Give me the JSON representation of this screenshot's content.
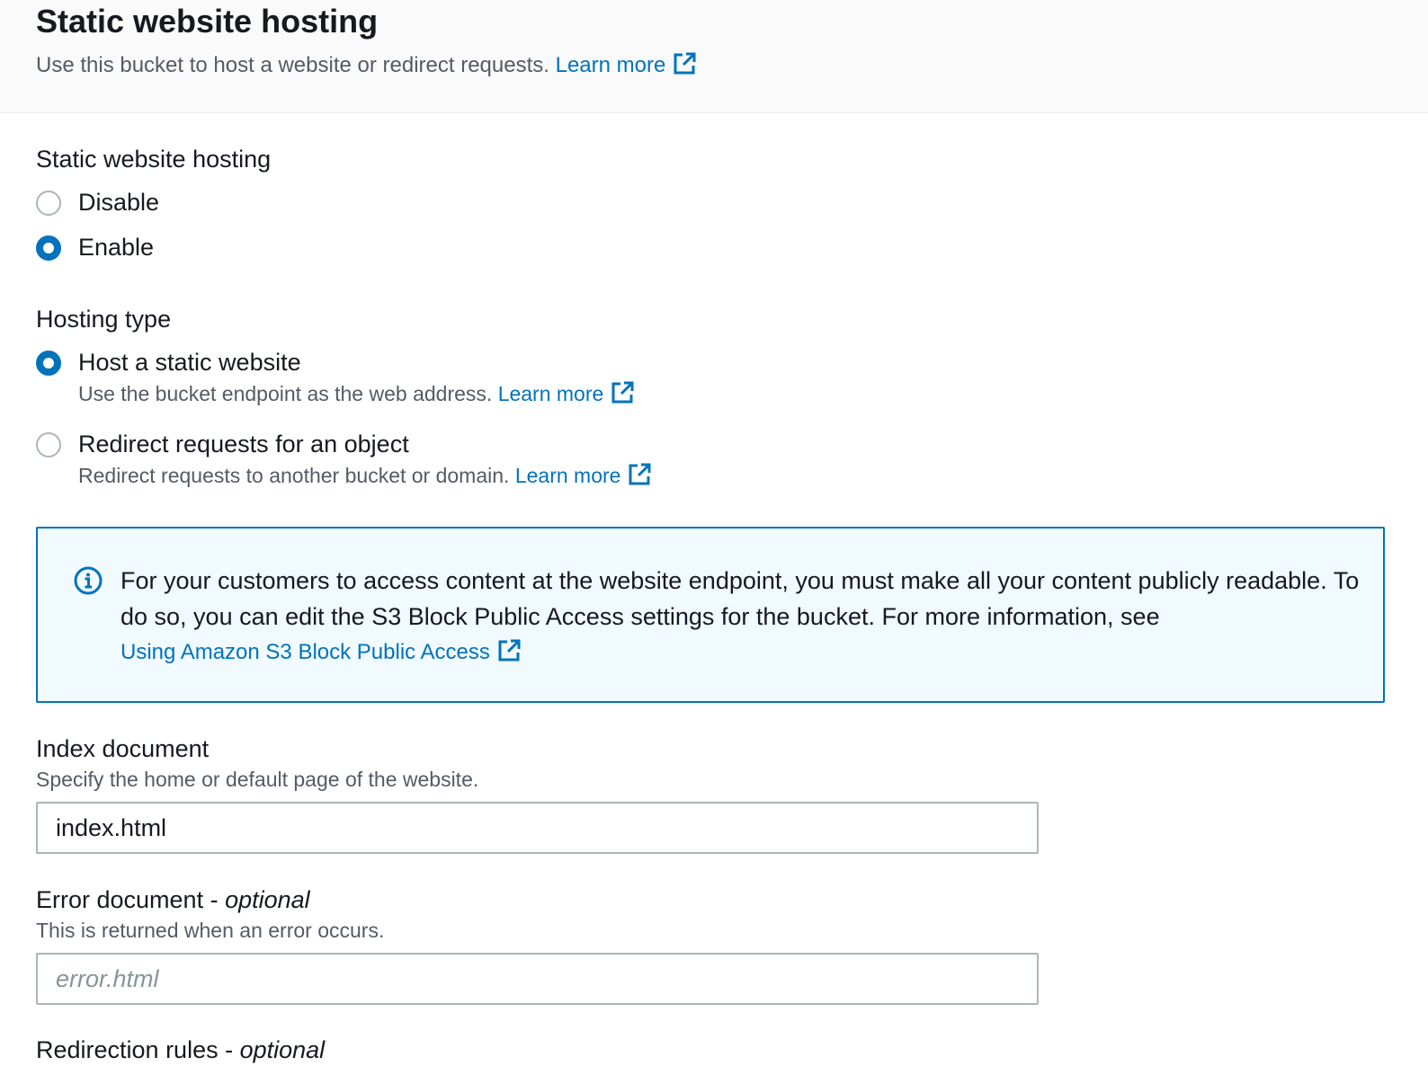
{
  "header": {
    "title": "Static website hosting",
    "description": "Use this bucket to host a website or redirect requests.",
    "learn_more": "Learn more"
  },
  "hosting_toggle": {
    "label": "Static website hosting",
    "options": [
      {
        "label": "Disable",
        "selected": false
      },
      {
        "label": "Enable",
        "selected": true
      }
    ]
  },
  "hosting_type": {
    "label": "Hosting type",
    "options": [
      {
        "label": "Host a static website",
        "description": "Use the bucket endpoint as the web address.",
        "learn_more": "Learn more",
        "selected": true
      },
      {
        "label": "Redirect requests for an object",
        "description": "Redirect requests to another bucket or domain.",
        "learn_more": "Learn more",
        "selected": false
      }
    ]
  },
  "info_alert": {
    "text": "For your customers to access content at the website endpoint, you must make all your content publicly readable. To do so, you can edit the S3 Block Public Access settings for the bucket. For more information, see",
    "link": "Using Amazon S3 Block Public Access"
  },
  "index_document": {
    "label": "Index document",
    "description": "Specify the home or default page of the website.",
    "value": "index.html"
  },
  "error_document": {
    "label": "Error document - ",
    "label_suffix": "optional",
    "description": "This is returned when an error occurs.",
    "placeholder": "error.html",
    "value": ""
  },
  "redirection_rules": {
    "label": "Redirection rules - ",
    "label_suffix": "optional"
  },
  "colors": {
    "accent": "#0073bb",
    "info_background": "#f1faff",
    "header_background": "#fafafa"
  },
  "icons": [
    "external-link-icon",
    "info-icon"
  ]
}
